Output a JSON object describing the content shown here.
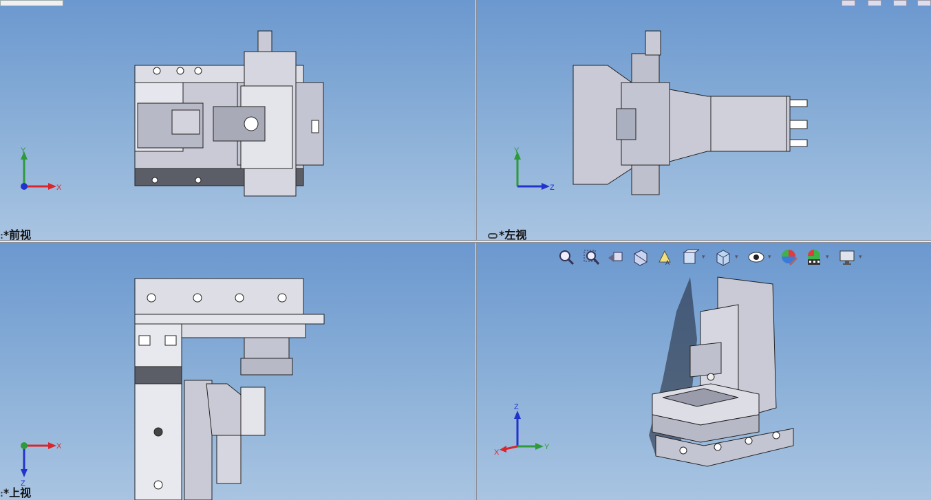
{
  "viewports": {
    "front": {
      "label": "*前视"
    },
    "left": {
      "label": "*左视"
    },
    "top": {
      "label": "*上视"
    },
    "iso": {
      "label": ""
    }
  },
  "axes": {
    "front": {
      "up": "Y",
      "right": "X"
    },
    "left": {
      "up": "Y",
      "right": "Z"
    },
    "top": {
      "down": "Z",
      "right": "X"
    },
    "iso": {
      "up": "Z",
      "left": "X",
      "right": "Y"
    }
  },
  "toolbar": {
    "items": [
      {
        "name": "zoom-to-fit-icon"
      },
      {
        "name": "zoom-to-area-icon"
      },
      {
        "name": "previous-view-icon"
      },
      {
        "name": "section-view-icon"
      },
      {
        "name": "dynamic-annotation-icon"
      },
      {
        "name": "view-orientation-icon"
      },
      {
        "name": "display-style-icon"
      },
      {
        "name": "hide-show-items-icon"
      },
      {
        "name": "edit-appearance-icon"
      },
      {
        "name": "apply-scene-icon"
      },
      {
        "name": "view-settings-icon"
      }
    ]
  },
  "colors": {
    "axis_x": "#d8262b",
    "axis_y": "#2e9a3a",
    "axis_z": "#2233cc",
    "part_fill": "#c9cad6",
    "part_dark": "#55585f",
    "part_edge": "#222"
  }
}
